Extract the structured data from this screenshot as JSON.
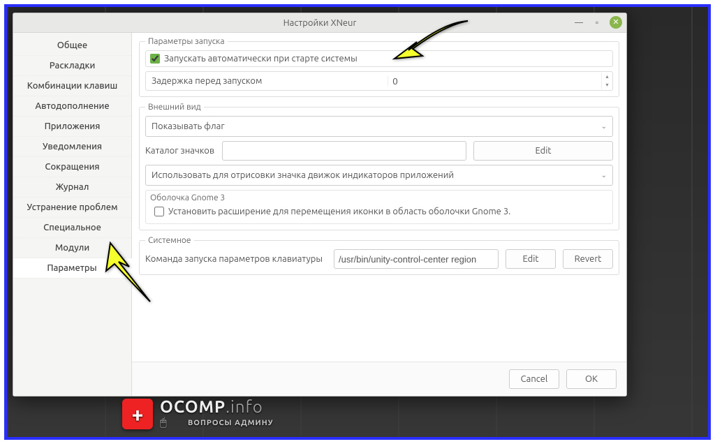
{
  "window": {
    "title": "Настройки XNeur"
  },
  "sidebar": {
    "items": [
      "Общее",
      "Раскладки",
      "Комбинации клавиш",
      "Автодополнение",
      "Приложения",
      "Уведомления",
      "Сокращения",
      "Журнал",
      "Устранение проблем",
      "Специальное",
      "Модули",
      "Параметры"
    ],
    "activeIndex": 11
  },
  "startup": {
    "legend": "Параметры запуска",
    "autostart_label": "Запускать автоматически при старте системы",
    "autostart_checked": true,
    "delay_label": "Задержка перед запуском",
    "delay_value": "0"
  },
  "appearance": {
    "legend": "Внешний вид",
    "show_flag_option": "Показывать флаг",
    "icon_dir_label": "Каталог значков",
    "icon_dir_value": "",
    "edit_label": "Edit",
    "engine_option": "Использовать для отрисовки значка движок индикаторов приложений",
    "gnome3_title": "Оболочка Gnome 3",
    "gnome3_check_label": "Установить расширение для перемещения иконки в область оболочки Gnome 3.",
    "gnome3_checked": false
  },
  "system": {
    "legend": "Системное",
    "command_label": "Команда запуска параметров клавиатуры",
    "command_value": "/usr/bin/unity-control-center region",
    "edit_label": "Edit",
    "revert_label": "Revert"
  },
  "footer": {
    "cancel": "Cancel",
    "ok": "OK"
  },
  "logo": {
    "brand_a": "OCOMP",
    "brand_b": ".info",
    "sub": "ВОПРОСЫ АДМИНУ"
  }
}
